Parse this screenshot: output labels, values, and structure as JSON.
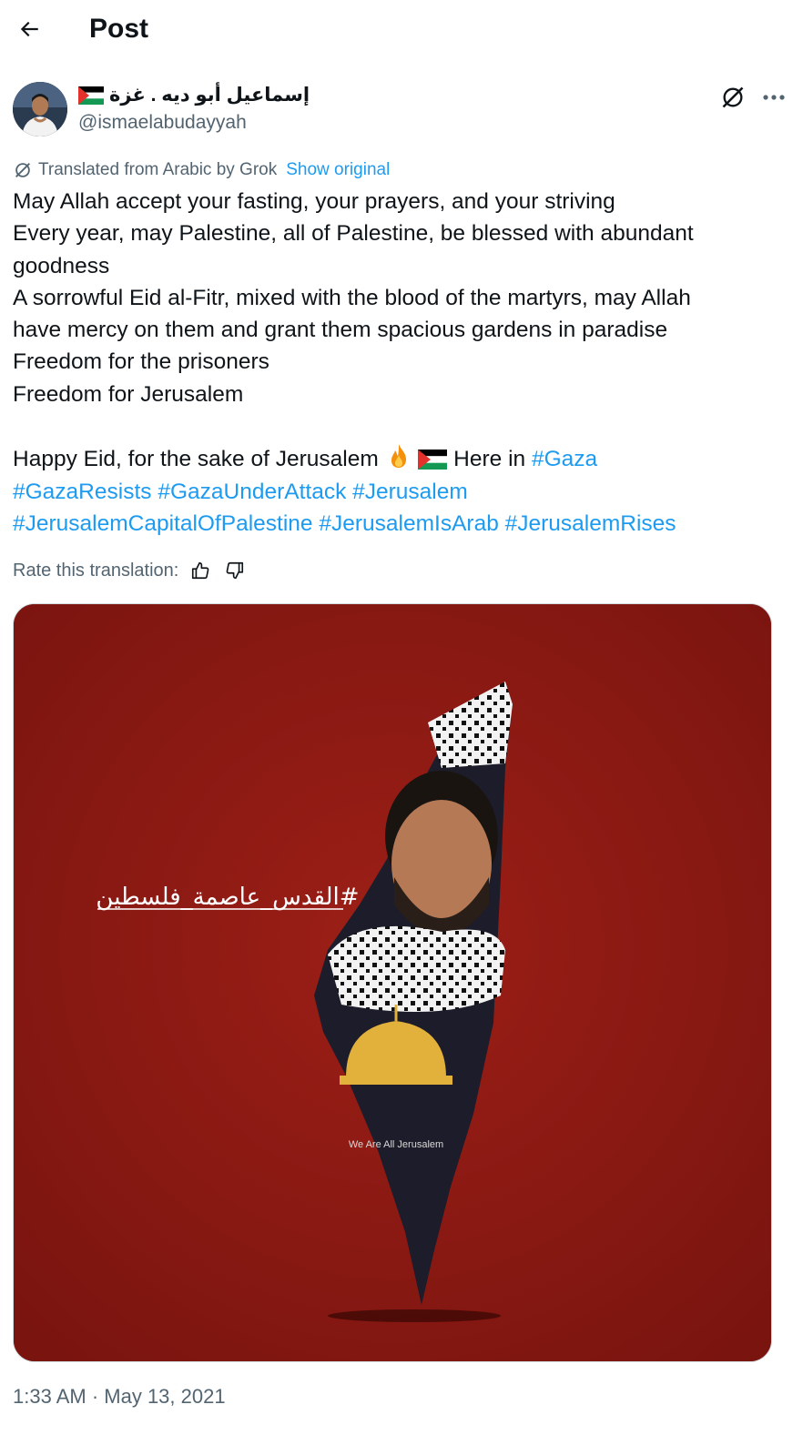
{
  "header": {
    "title": "Post"
  },
  "author": {
    "display_name": "إسماعيل أبو ديه . غزة",
    "flag_emoji": "palestine-flag",
    "handle": "@ismaelabudayyah"
  },
  "translation": {
    "notice": "Translated from Arabic by Grok",
    "show_original": "Show original",
    "rate_label": "Rate this translation:"
  },
  "tweet": {
    "lines": [
      "May Allah accept your fasting, your prayers, and your striving",
      "Every year, may Palestine, all of Palestine, be blessed with abundant",
      "goodness",
      "A sorrowful Eid al-Fitr, mixed with the blood of the martyrs, may Allah",
      "have mercy on them and grant them spacious gardens in paradise",
      "Freedom for the prisoners",
      "Freedom for Jerusalem"
    ],
    "eid_text_before": "Happy Eid, for the sake of Jerusalem",
    "eid_text_after": "Here in",
    "hashtags": {
      "gaza": "#Gaza",
      "gaza_resists": "#GazaResists",
      "gaza_under_attack": "#GazaUnderAttack",
      "jerusalem": "#Jerusalem",
      "jerusalem_capital": "#JerusalemCapitalOfPalestine",
      "jerusalem_is_arab": "#JerusalemIsArab",
      "jerusalem_rises": "#JerusalemRises"
    }
  },
  "media": {
    "overlay_hashtag": "#القدس_عاصمة_فلسطين",
    "shirt_text": "We Are All Jerusalem",
    "background_color": "#8e1a14"
  },
  "timestamp": "1:33 AM · May 13, 2021",
  "colors": {
    "link": "#1d9bf0",
    "secondary": "#536471",
    "text": "#0f1419"
  }
}
